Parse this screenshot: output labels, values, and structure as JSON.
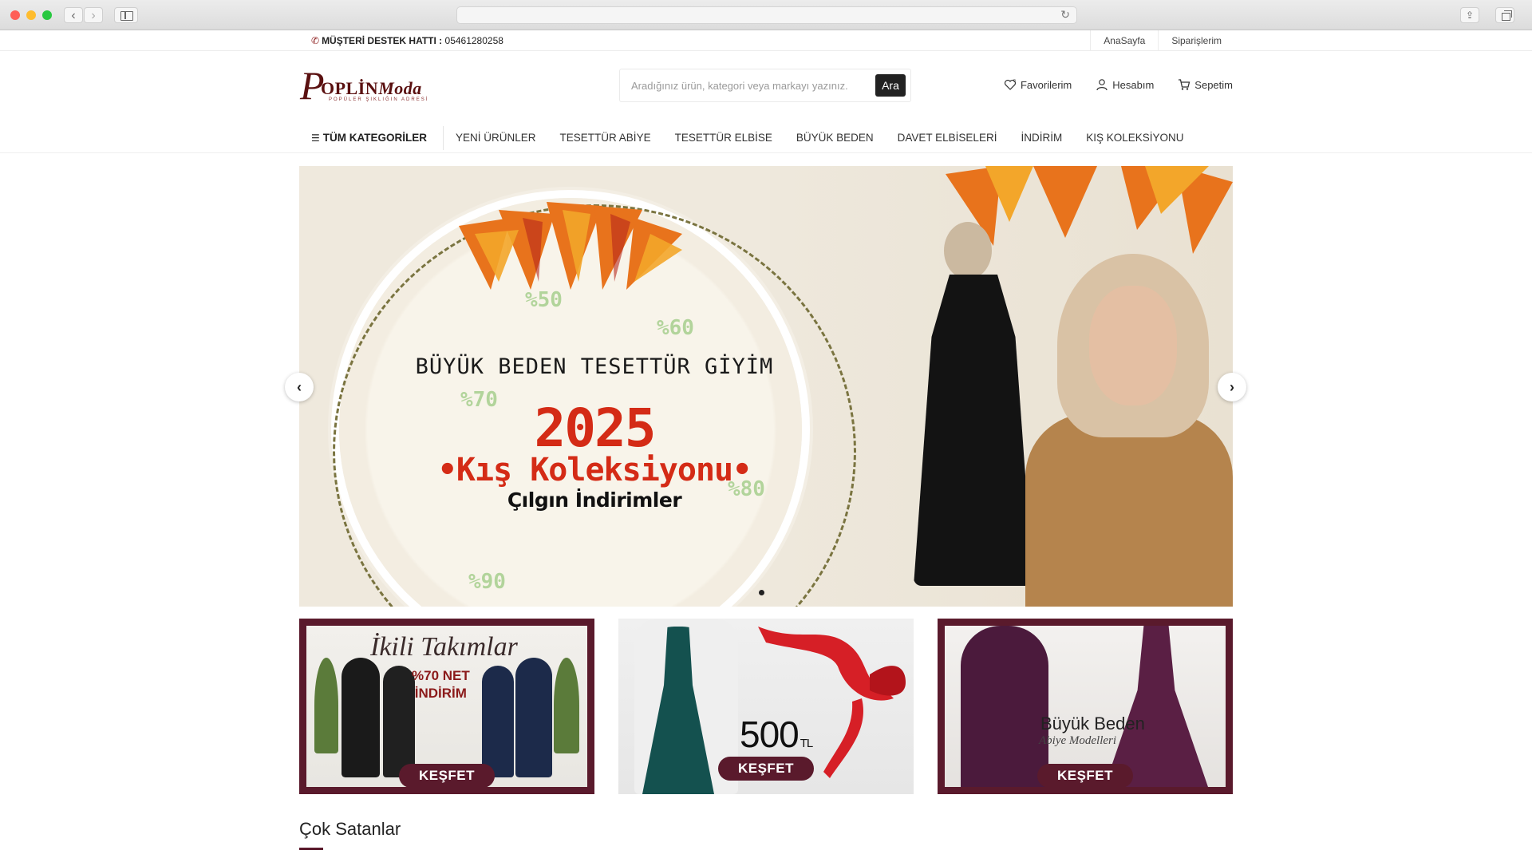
{
  "topbar": {
    "support_label": "MÜŞTERİ DESTEK HATTI :",
    "support_phone": "05461280258",
    "links": [
      "AnaSayfa",
      "Siparişlerim"
    ]
  },
  "header": {
    "logo_text_p": "P",
    "logo_text_rest": "OPLİN",
    "logo_text_moda": "Moda",
    "logo_tagline": "POPÜLER ŞIKLIĞIN ADRESİ",
    "search_placeholder": "Aradığınız ürün, kategori veya markayı yazınız.",
    "search_button": "Ara",
    "actions": {
      "favorites": "Favorilerim",
      "account": "Hesabım",
      "cart": "Sepetim"
    }
  },
  "nav": {
    "all_categories": "TÜM KATEGORİLER",
    "items": [
      "YENİ ÜRÜNLER",
      "TESETTÜR ABİYE",
      "TESETTÜR ELBİSE",
      "BÜYÜK BEDEN",
      "DAVET ELBİSELERİ",
      "İNDİRİM",
      "KIŞ KOLEKSİYONU"
    ]
  },
  "hero": {
    "title": "BÜYÜK BEDEN TESETTÜR GİYİM",
    "year": "2025",
    "collection": "•Kış Koleksiyonu•",
    "subtitle": "Çılgın İndirimler",
    "percents": [
      "%50",
      "%60",
      "%70",
      "%80",
      "%90"
    ]
  },
  "promos": [
    {
      "script": "İkili Takımlar",
      "line1": "%70 NET",
      "line2": "İNDİRİM",
      "cta": "KEŞFET"
    },
    {
      "price": "500",
      "currency": "TL",
      "cta": "KEŞFET"
    },
    {
      "title": "Büyük Beden",
      "script": "Abiye Modelleri",
      "cta": "KEŞFET"
    }
  ],
  "section": {
    "title": "Çok Satanlar"
  },
  "colors": {
    "brand": "#5a1a2c",
    "hero_red": "#d42b16"
  }
}
